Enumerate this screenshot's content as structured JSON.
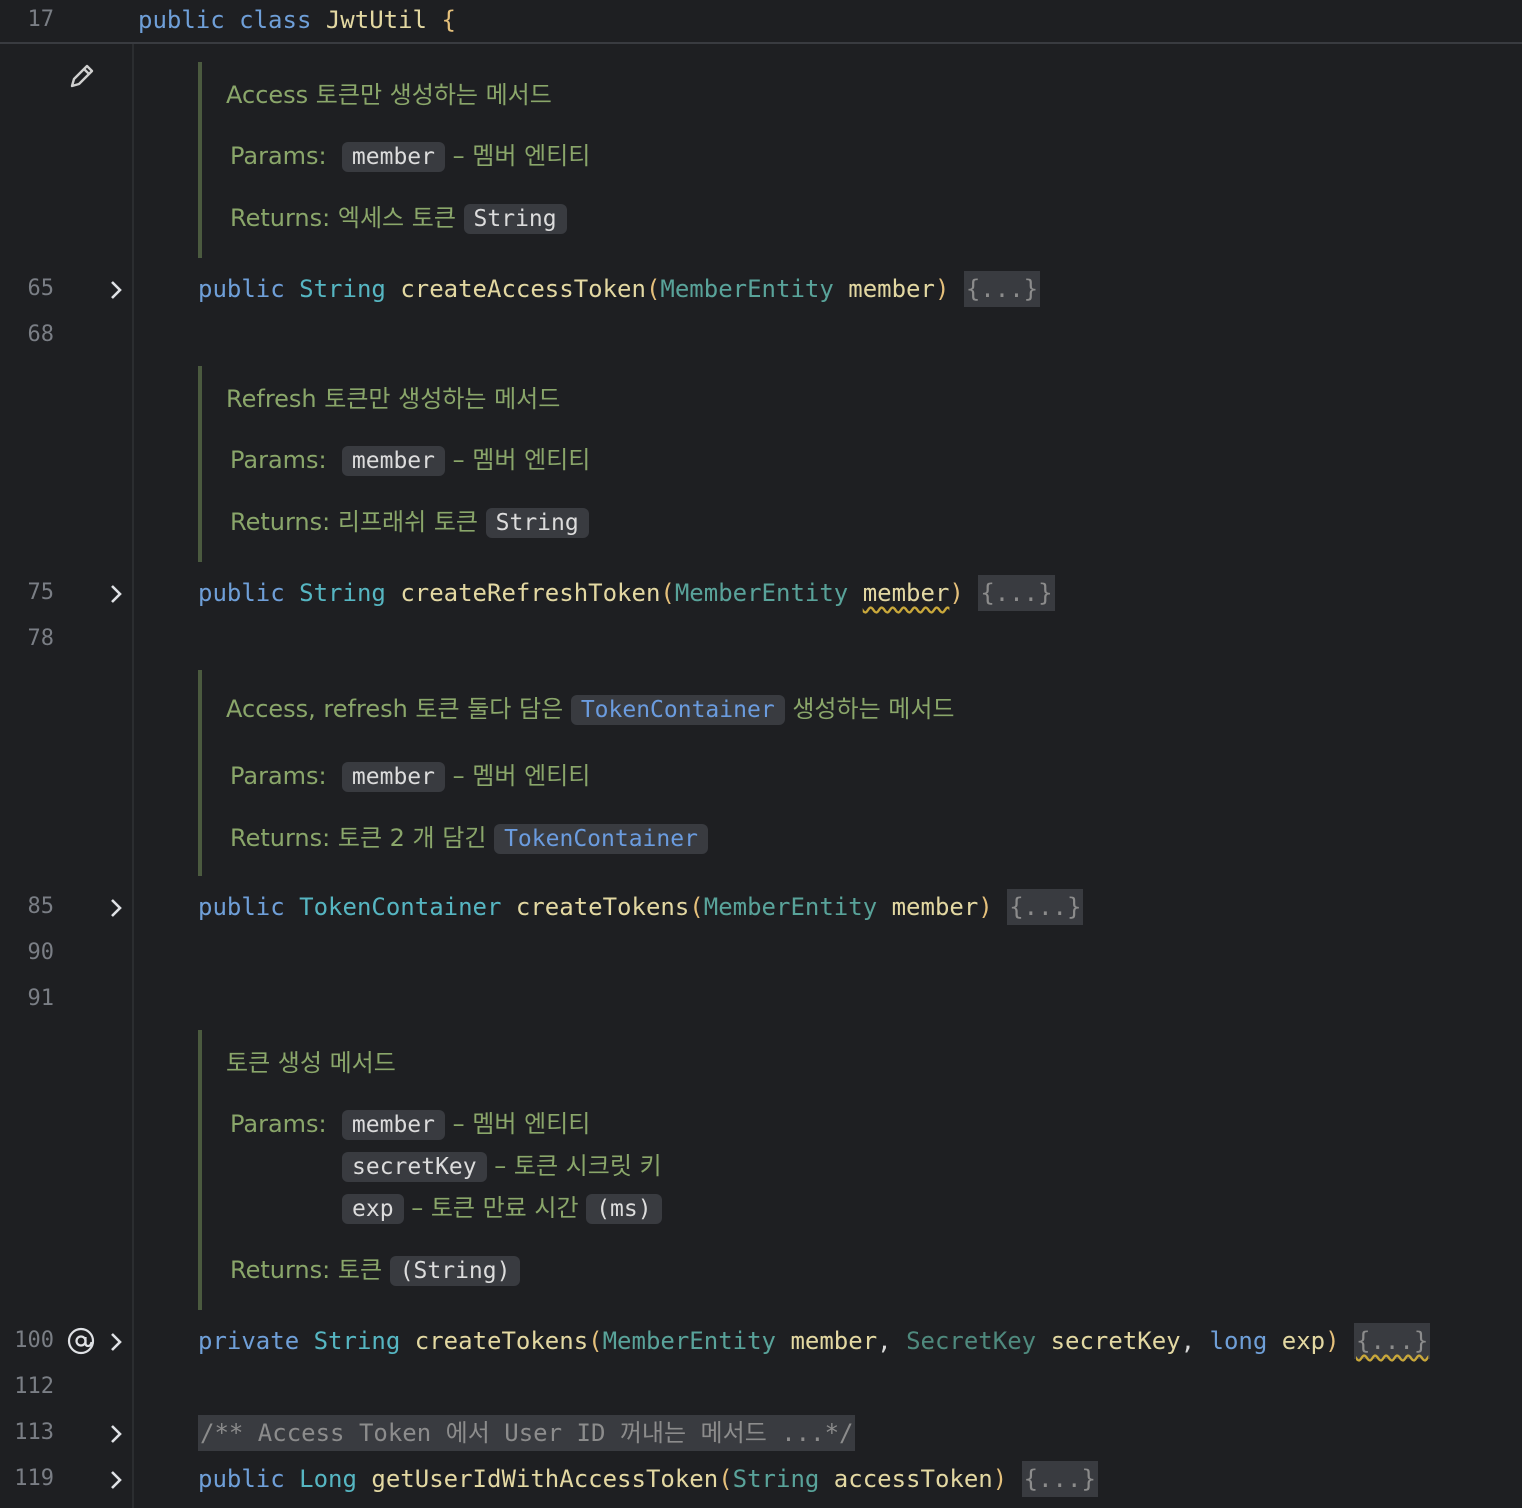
{
  "sticky": {
    "line": "17",
    "kw1": "public",
    "kw2": "class",
    "name": "JwtUtil",
    "brace": "{"
  },
  "line_numbers": {
    "l65": "65",
    "l68": "68",
    "l75": "75",
    "l78": "78",
    "l85": "85",
    "l90": "90",
    "l91": "91",
    "l100": "100",
    "l112": "112",
    "l113": "113",
    "l119": "119"
  },
  "doc1": {
    "summary": "Access 토큰만 생성하는 메서드",
    "params_label": "Params:",
    "param": "member",
    "param_desc": "– 멤버 엔티티",
    "returns_label": "Returns:",
    "returns_desc": "엑세스 토큰",
    "returns_type": "String"
  },
  "method1": {
    "mod": "public",
    "type": "String",
    "name": "createAccessToken",
    "open": "(",
    "ptype": "MemberEntity",
    "pname": "member",
    "close": ")",
    "fold": "{...}"
  },
  "doc2": {
    "summary": "Refresh 토큰만 생성하는 메서드",
    "params_label": "Params:",
    "param": "member",
    "param_desc": "– 멤버 엔티티",
    "returns_label": "Returns:",
    "returns_desc": "리프래쉬 토큰",
    "returns_type": "String"
  },
  "method2": {
    "mod": "public",
    "type": "String",
    "name": "createRefreshToken",
    "open": "(",
    "ptype": "MemberEntity",
    "pname": "member",
    "close": ")",
    "fold": "{...}"
  },
  "doc3": {
    "summary_pre": "Access, refresh 토큰 둘다 담은",
    "summary_chip": "TokenContainer",
    "summary_post": "생성하는 메서드",
    "params_label": "Params:",
    "param": "member",
    "param_desc": "– 멤버 엔티티",
    "returns_label": "Returns:",
    "returns_desc": "토큰 2 개 담긴",
    "returns_type": "TokenContainer"
  },
  "method3": {
    "mod": "public",
    "type": "TokenContainer",
    "name": "createTokens",
    "open": "(",
    "ptype": "MemberEntity",
    "pname": "member",
    "close": ")",
    "fold": "{...}"
  },
  "doc4": {
    "summary": "토큰 생성 메서드",
    "params_label": "Params:",
    "param1": "member",
    "param1_desc": "– 멤버 엔티티",
    "param2": "secretKey",
    "param2_desc": "– 토큰 시크릿 키",
    "param3": "exp",
    "param3_desc": "– 토큰 만료 시간",
    "param3_unit": "(ms)",
    "returns_label": "Returns:",
    "returns_desc": "토큰",
    "returns_type": "(String)"
  },
  "method4": {
    "mod": "private",
    "type": "String",
    "name": "createTokens",
    "open": "(",
    "p1type": "MemberEntity",
    "p1name": "member",
    "comma1": ",",
    "p2type": "SecretKey",
    "p2name": "secretKey",
    "comma2": ",",
    "p3type": "long",
    "p3name": "exp",
    "close": ")",
    "fold": "{...}"
  },
  "comment5": {
    "text": "/** Access Token 에서 User ID 꺼내는 메서드 ...*/"
  },
  "method5": {
    "mod": "public",
    "type": "Long",
    "name": "getUserIdWithAccessToken",
    "open": "(",
    "ptype": "String",
    "pname": "accessToken",
    "close": ")",
    "fold": "{...}"
  },
  "icons": {
    "edit": "pencil-icon",
    "fold": "chevron-right-icon",
    "override": "at-sign-icon"
  }
}
